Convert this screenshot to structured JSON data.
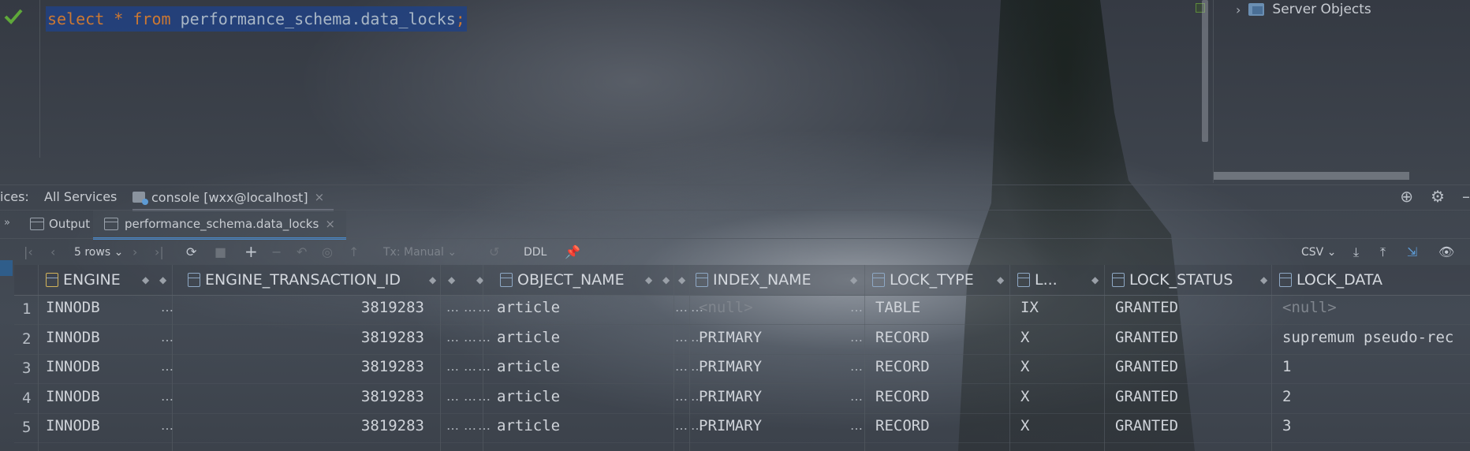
{
  "editor": {
    "kw_select": "select",
    "star": " * ",
    "kw_from": "from",
    "table": " performance_schema.data_locks",
    "semicolon": ";"
  },
  "tree": {
    "item": "Server Objects"
  },
  "services": {
    "label": "ices:",
    "all": "All Services",
    "console": "console [wxx@localhost]",
    "close": "×"
  },
  "results": {
    "output": "Output",
    "tab": "performance_schema.data_locks",
    "close": "×",
    "more": "»"
  },
  "toolbar": {
    "rows": "5 rows",
    "tx": "Tx: Manual",
    "ddl": "DDL",
    "csv": "CSV"
  },
  "grid": {
    "headers": {
      "engine": "ENGINE",
      "engine_transaction_id": "ENGINE_TRANSACTION_ID",
      "object_name": "OBJECT_NAME",
      "index_name": "INDEX_NAME",
      "lock_type": "LOCK_TYPE",
      "lock_mode": "L...",
      "lock_status": "LOCK_STATUS",
      "lock_data": "LOCK_DATA"
    },
    "ellipsis": "…",
    "rows": [
      {
        "n": "1",
        "engine": "INNODB",
        "trx": "3819283",
        "object": "article",
        "index": "<null>",
        "type": "TABLE",
        "mode": "IX",
        "status": "GRANTED",
        "data": "<null>"
      },
      {
        "n": "2",
        "engine": "INNODB",
        "trx": "3819283",
        "object": "article",
        "index": "PRIMARY",
        "type": "RECORD",
        "mode": "X",
        "status": "GRANTED",
        "data": "supremum pseudo-rec"
      },
      {
        "n": "3",
        "engine": "INNODB",
        "trx": "3819283",
        "object": "article",
        "index": "PRIMARY",
        "type": "RECORD",
        "mode": "X",
        "status": "GRANTED",
        "data": "1"
      },
      {
        "n": "4",
        "engine": "INNODB",
        "trx": "3819283",
        "object": "article",
        "index": "PRIMARY",
        "type": "RECORD",
        "mode": "X",
        "status": "GRANTED",
        "data": "2"
      },
      {
        "n": "5",
        "engine": "INNODB",
        "trx": "3819283",
        "object": "article",
        "index": "PRIMARY",
        "type": "RECORD",
        "mode": "X",
        "status": "GRANTED",
        "data": "3"
      }
    ]
  },
  "colors": {
    "keyword": "#cc7832",
    "selection": "#214283",
    "tab_underline": "#4a88c7",
    "check": "#5fa83a"
  }
}
